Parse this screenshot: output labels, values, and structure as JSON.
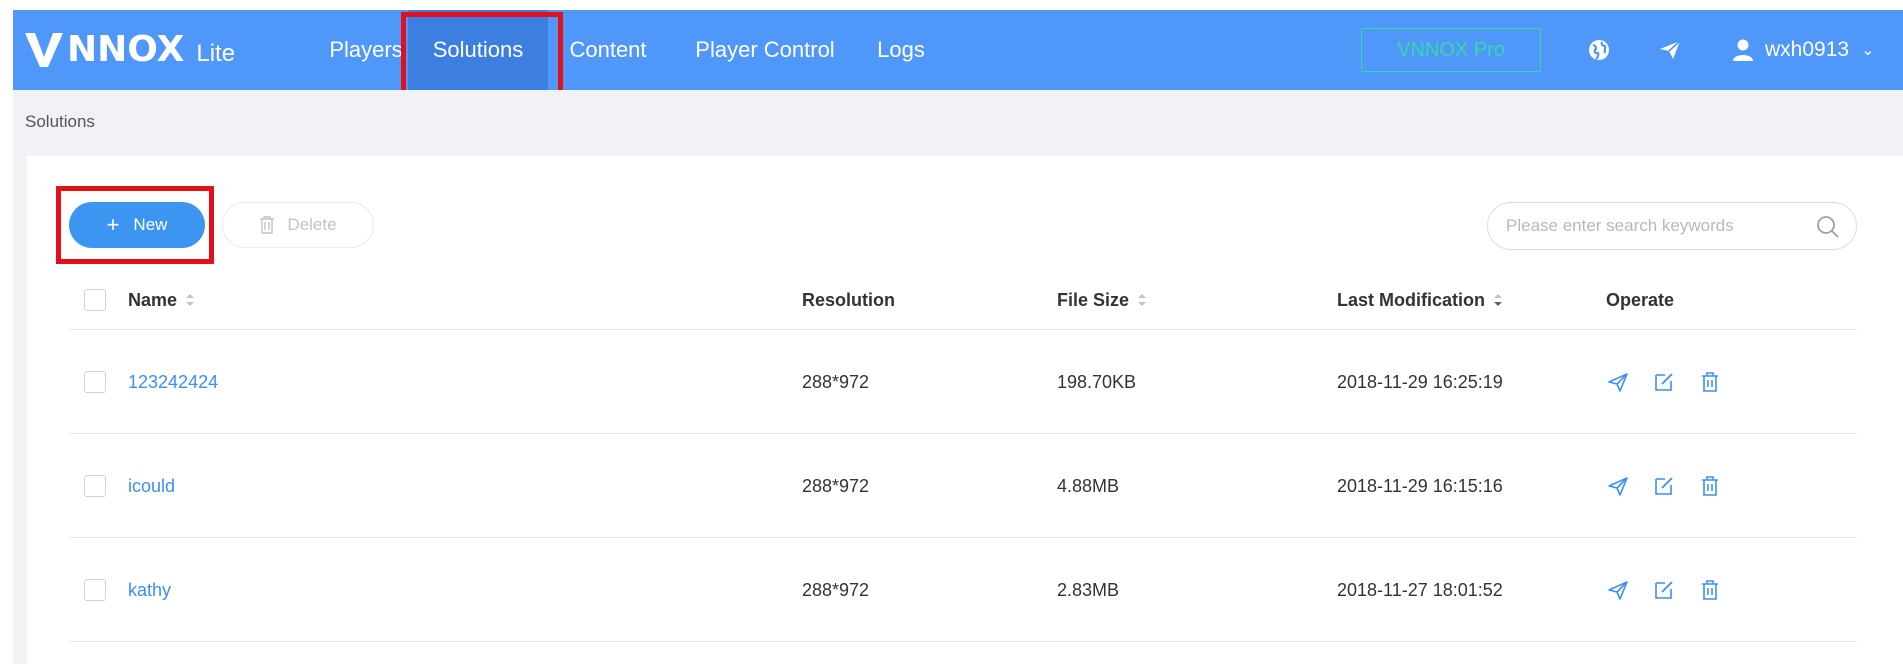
{
  "brand": {
    "logo_text": "NNOX",
    "edition": "Lite"
  },
  "nav": [
    {
      "label": "Players",
      "active": false
    },
    {
      "label": "Solutions",
      "active": true
    },
    {
      "label": "Content",
      "active": false
    },
    {
      "label": "Player Control",
      "active": false
    },
    {
      "label": "Logs",
      "active": false
    }
  ],
  "header": {
    "pro_label": "VNNOX Pro",
    "icons": [
      "globe-icon",
      "send-icon"
    ],
    "user": {
      "name": "wxh0913",
      "icon": "user-icon"
    }
  },
  "breadcrumb": "Solutions",
  "toolbar": {
    "new_label": "New",
    "delete_label": "Delete",
    "search_placeholder": "Please enter search keywords"
  },
  "table": {
    "columns": {
      "name": "Name",
      "resolution": "Resolution",
      "size": "File Size",
      "modified": "Last Modification",
      "operate": "Operate"
    },
    "rows": [
      {
        "name": "123242424",
        "resolution": "288*972",
        "size": "198.70KB",
        "modified": "2018-11-29 16:25:19"
      },
      {
        "name": "icould",
        "resolution": "288*972",
        "size": "4.88MB",
        "modified": "2018-11-29 16:15:16"
      },
      {
        "name": "kathy",
        "resolution": "288*972",
        "size": "2.83MB",
        "modified": "2018-11-27 18:01:52"
      }
    ],
    "row_actions": [
      "publish-icon",
      "edit-icon",
      "trash-icon"
    ]
  },
  "colors": {
    "header_bg": "#4f97f9",
    "nav_active": "#3c7fe0",
    "accent": "#3d95f2",
    "pro": "#36d9a6",
    "link": "#3d8ff0",
    "highlight": "#e3101a"
  }
}
